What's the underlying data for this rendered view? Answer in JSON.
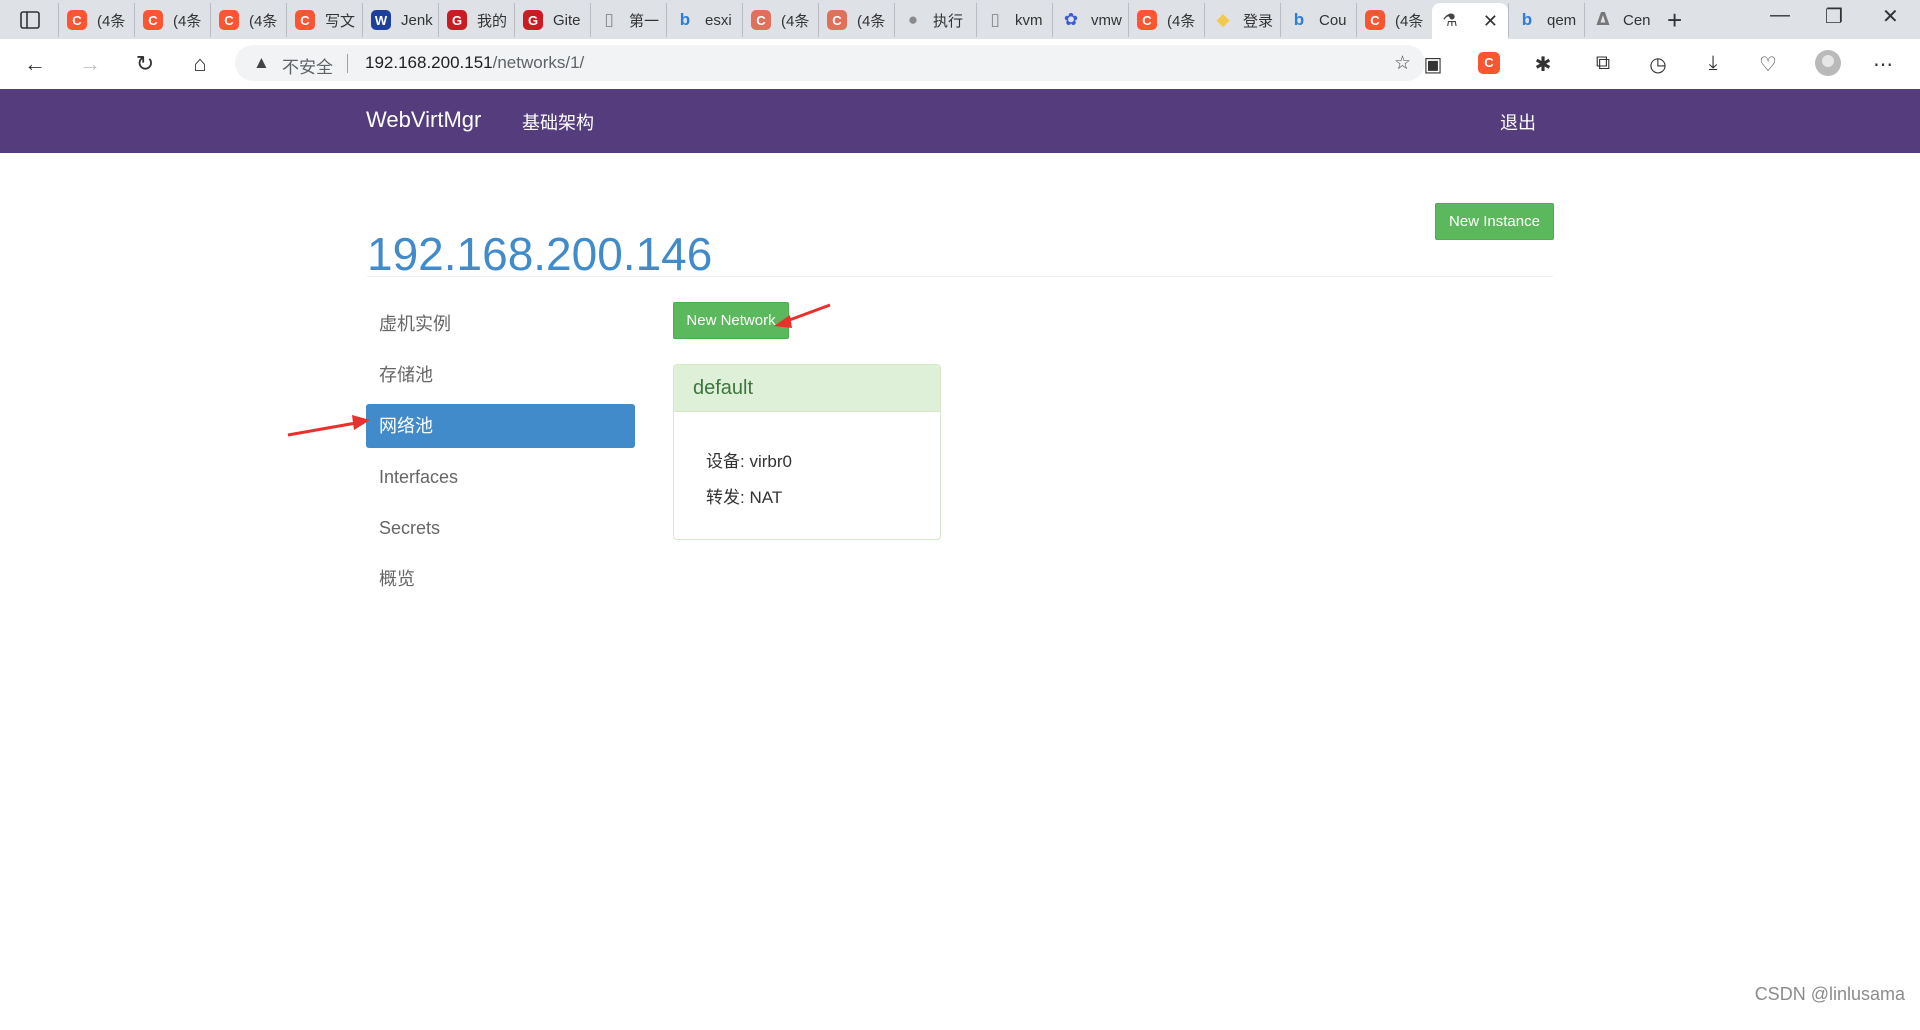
{
  "browser": {
    "tabs": [
      {
        "label": "(4条",
        "icon": "csdn-icon",
        "color": "#fc5531",
        "glyph": "C"
      },
      {
        "label": "(4条",
        "icon": "csdn-icon",
        "color": "#fc5531",
        "glyph": "C"
      },
      {
        "label": "(4条",
        "icon": "csdn-icon",
        "color": "#fc5531",
        "glyph": "C"
      },
      {
        "label": "写文",
        "icon": "csdn-icon",
        "color": "#fc5531",
        "glyph": "C"
      },
      {
        "label": "Jenk",
        "icon": "w-icon",
        "color": "#1e3f9c",
        "glyph": "W"
      },
      {
        "label": "我的",
        "icon": "gitee-icon",
        "color": "#c71d23",
        "glyph": "G"
      },
      {
        "label": "Gite",
        "icon": "gitee-icon",
        "color": "#c71d23",
        "glyph": "G"
      },
      {
        "label": "第一",
        "icon": "page-icon",
        "color": "#888888",
        "glyph": "▯"
      },
      {
        "label": "esxi",
        "icon": "bing-icon",
        "color": "#2b7fd8",
        "glyph": "b"
      },
      {
        "label": "(4条",
        "icon": "csdn-icon",
        "color": "#e0705a",
        "glyph": "C"
      },
      {
        "label": "(4条",
        "icon": "csdn-icon",
        "color": "#e0705a",
        "glyph": "C"
      },
      {
        "label": "执行",
        "icon": "avatar-icon",
        "color": "#8a8a8a",
        "glyph": "●"
      },
      {
        "label": "kvm",
        "icon": "page-icon",
        "color": "#888888",
        "glyph": "▯"
      },
      {
        "label": "vmw",
        "icon": "baidu-icon",
        "color": "#3b5bdb",
        "glyph": "✿"
      },
      {
        "label": "(4条",
        "icon": "csdn-icon",
        "color": "#fc5531",
        "glyph": "C"
      },
      {
        "label": "登录",
        "icon": "python-icon",
        "color": "#f2c94c",
        "glyph": "◆"
      },
      {
        "label": "Cou",
        "icon": "bing-icon",
        "color": "#2b7fd8",
        "glyph": "b"
      },
      {
        "label": "(4条",
        "icon": "csdn-icon",
        "color": "#fc5531",
        "glyph": "C"
      },
      {
        "label": "",
        "icon": "webvirt-icon",
        "color": "#444444",
        "glyph": "⚗",
        "active": true
      },
      {
        "label": "qem",
        "icon": "bing-icon",
        "color": "#2b7fd8",
        "glyph": "b"
      },
      {
        "label": "Cen",
        "icon": "centos-icon",
        "color": "#777777",
        "glyph": "ᐃ"
      }
    ],
    "address": {
      "security_label": "不安全",
      "url_host": "192.168.200.151",
      "url_path": "/networks/1/"
    }
  },
  "navbar": {
    "brand": "WebVirtMgr",
    "infrastructure": "基础架构",
    "logout": "退出"
  },
  "page": {
    "host_title": "192.168.200.146",
    "new_instance": "New Instance",
    "new_network": "New Network"
  },
  "sidebar": {
    "items": [
      {
        "label": "虚机实例",
        "active": false
      },
      {
        "label": "存储池",
        "active": false
      },
      {
        "label": "网络池",
        "active": true
      },
      {
        "label": "Interfaces",
        "active": false
      },
      {
        "label": "Secrets",
        "active": false
      },
      {
        "label": "概览",
        "active": false
      }
    ]
  },
  "network": {
    "name": "default",
    "device_label": "设备:",
    "device_value": "virbr0",
    "forward_label": "转发:",
    "forward_value": "NAT"
  },
  "watermark": "CSDN @linlusama",
  "colors": {
    "navbar": "#553c7c",
    "success": "#5cb85c",
    "primary": "#428bca",
    "panel_heading": "#dff0d8",
    "annotation_arrow": "#e8312c"
  }
}
